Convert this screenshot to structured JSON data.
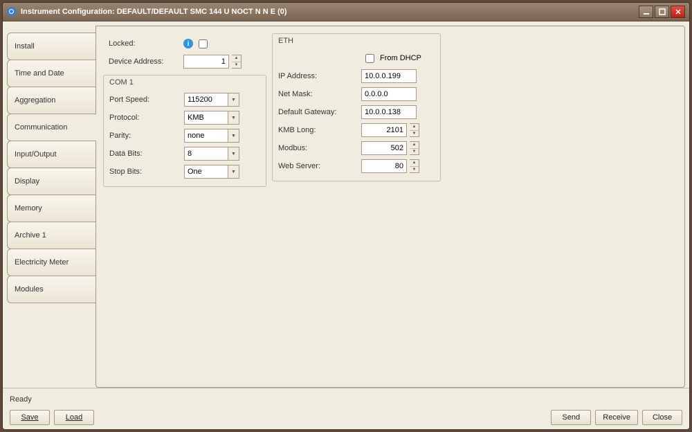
{
  "window": {
    "title": "Instrument Configuration: DEFAULT/DEFAULT      SMC 144 U NOCT N N E (0)"
  },
  "tabs": [
    "Install",
    "Time and Date",
    "Aggregation",
    "Communication",
    "Input/Output",
    "Display",
    "Memory",
    "Archive 1",
    "Electricity Meter",
    "Modules"
  ],
  "active_tab": "Communication",
  "general": {
    "locked_label": "Locked:",
    "locked": false,
    "device_address_label": "Device Address:",
    "device_address": "1"
  },
  "com1": {
    "title": "COM 1",
    "port_speed_label": "Port Speed:",
    "port_speed": "115200",
    "protocol_label": "Protocol:",
    "protocol": "KMB",
    "parity_label": "Parity:",
    "parity": "none",
    "data_bits_label": "Data Bits:",
    "data_bits": "8",
    "stop_bits_label": "Stop Bits:",
    "stop_bits": "One"
  },
  "eth": {
    "title": "ETH",
    "from_dhcp_label": "From DHCP",
    "from_dhcp": false,
    "ip_label": "IP Address:",
    "ip": "10.0.0.199",
    "mask_label": "Net Mask:",
    "mask": "0.0.0.0",
    "gw_label": "Default Gateway:",
    "gw": "10.0.0.138",
    "kmb_long_label": "KMB Long:",
    "kmb_long": "2101",
    "modbus_label": "Modbus:",
    "modbus": "502",
    "web_label": "Web Server:",
    "web": "80"
  },
  "status": "Ready",
  "buttons": {
    "save": "Save",
    "load": "Load",
    "send": "Send",
    "receive": "Receive",
    "close": "Close"
  }
}
